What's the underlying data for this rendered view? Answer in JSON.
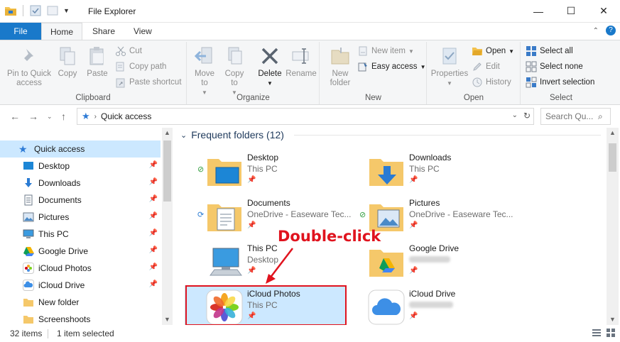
{
  "window": {
    "title": "File Explorer",
    "minimize_glyph": "—",
    "maximize_glyph": "☐",
    "close_glyph": "✕"
  },
  "ribbon_tabs": {
    "file": "File",
    "home": "Home",
    "share": "Share",
    "view": "View"
  },
  "ribbon": {
    "clipboard": {
      "label": "Clipboard",
      "pin_to_quick_access": "Pin to Quick access",
      "copy": "Copy",
      "paste": "Paste",
      "cut": "Cut",
      "copy_path": "Copy path",
      "paste_shortcut": "Paste shortcut"
    },
    "organize": {
      "label": "Organize",
      "move_to": "Move to",
      "copy_to": "Copy to",
      "delete": "Delete",
      "rename": "Rename"
    },
    "new": {
      "label": "New",
      "new_folder": "New folder",
      "new_item": "New item",
      "easy_access": "Easy access"
    },
    "open": {
      "label": "Open",
      "properties": "Properties",
      "open": "Open",
      "edit": "Edit",
      "history": "History"
    },
    "select": {
      "label": "Select",
      "select_all": "Select all",
      "select_none": "Select none",
      "invert_selection": "Invert selection"
    }
  },
  "address": {
    "location": "Quick access",
    "search_placeholder": "Search Qu..."
  },
  "nav_pane": {
    "items": [
      {
        "label": "Quick access",
        "icon": "star-icon",
        "pinned": false,
        "selected": true
      },
      {
        "label": "Desktop",
        "icon": "desktop-icon",
        "pinned": true
      },
      {
        "label": "Downloads",
        "icon": "download-icon",
        "pinned": true
      },
      {
        "label": "Documents",
        "icon": "document-icon",
        "pinned": true
      },
      {
        "label": "Pictures",
        "icon": "pictures-icon",
        "pinned": true
      },
      {
        "label": "This PC",
        "icon": "computer-icon",
        "pinned": true
      },
      {
        "label": "Google Drive",
        "icon": "google-drive-icon",
        "pinned": true
      },
      {
        "label": "iCloud Photos",
        "icon": "icloud-photos-icon",
        "pinned": true
      },
      {
        "label": "iCloud Drive",
        "icon": "icloud-drive-icon",
        "pinned": true
      },
      {
        "label": "New folder",
        "icon": "folder-icon",
        "pinned": false
      },
      {
        "label": "Screenshoots",
        "icon": "folder-icon",
        "pinned": false
      }
    ]
  },
  "content": {
    "group_title": "Frequent folders (12)",
    "tiles": [
      {
        "name": "Desktop",
        "sub": "This PC",
        "icon": "desktop-folder-icon",
        "status": "synced"
      },
      {
        "name": "Downloads",
        "sub": "This PC",
        "icon": "downloads-folder-icon",
        "status": ""
      },
      {
        "name": "Documents",
        "sub": "OneDrive - Easeware Tec...",
        "icon": "documents-folder-icon",
        "status": "syncing"
      },
      {
        "name": "Pictures",
        "sub": "OneDrive - Easeware Tec...",
        "icon": "pictures-folder-icon",
        "status": "synced"
      },
      {
        "name": "This PC",
        "sub": "Desktop",
        "icon": "computer-icon",
        "status": ""
      },
      {
        "name": "Google Drive",
        "sub": "",
        "icon": "google-drive-folder-icon",
        "status": ""
      },
      {
        "name": "iCloud Photos",
        "sub": "This PC",
        "icon": "icloud-photos-icon",
        "status": "",
        "selected": true
      },
      {
        "name": "iCloud Drive",
        "sub": "",
        "icon": "icloud-drive-icon",
        "status": ""
      }
    ]
  },
  "annotation": {
    "text": "Double-click",
    "color": "#e0131e"
  },
  "status": {
    "items": "32 items",
    "selected": "1 item selected"
  },
  "colors": {
    "accent": "#1979ca",
    "selection": "#cce8ff",
    "folder": "#f5c86a"
  }
}
